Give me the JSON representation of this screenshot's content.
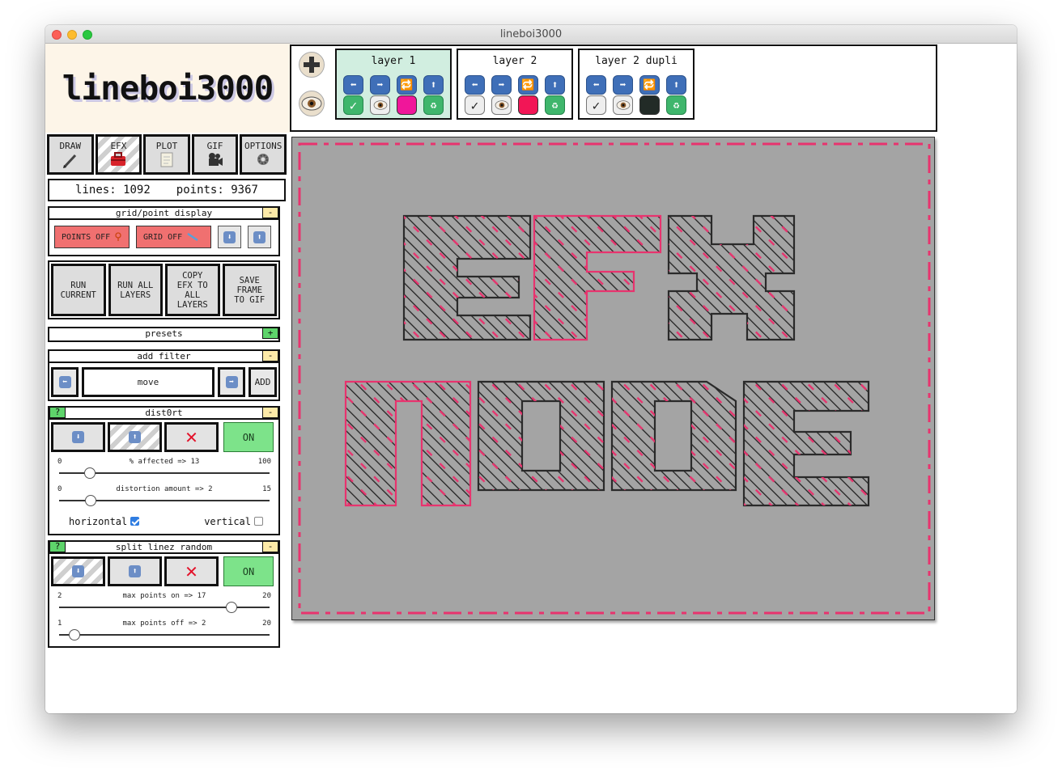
{
  "window": {
    "title": "lineboi3000"
  },
  "app": {
    "logo": "lineboi3000"
  },
  "modes": [
    {
      "label": "DRAW",
      "icon": "pen-icon",
      "active": false
    },
    {
      "label": "EFX",
      "icon": "toolbox-icon",
      "active": true
    },
    {
      "label": "PLOT",
      "icon": "paper-icon",
      "active": false
    },
    {
      "label": "GIF",
      "icon": "camera-icon",
      "active": false
    },
    {
      "label": "OPTIONS",
      "icon": "gear-icon",
      "active": false
    }
  ],
  "stats": {
    "lines_label": "lines:",
    "lines": "1092",
    "points_label": "points:",
    "points": "9367"
  },
  "grid_panel": {
    "title": "grid/point display",
    "toggle": "-",
    "points_btn": "POINTS OFF",
    "grid_btn": "GRID OFF"
  },
  "run": {
    "run_current": "RUN\nCURRENT",
    "run_all": "RUN ALL\nLAYERS",
    "copy_efx": "COPY\nEFX TO\nALL\nLAYERS",
    "save_frame": "SAVE\nFRAME\nTO GIF"
  },
  "presets": {
    "title": "presets",
    "toggle": "+"
  },
  "add_filter": {
    "title": "add filter",
    "toggle": "-",
    "current": "move",
    "add_label": "ADD"
  },
  "distort": {
    "title": "dist0rt",
    "help": "?",
    "toggle": "-",
    "on_label": "ON",
    "slider1": {
      "label": "% affected => 13",
      "min": "0",
      "max": "100",
      "value": 13
    },
    "slider2": {
      "label": "distortion amount => 2",
      "min": "0",
      "max": "15",
      "value": 2
    },
    "horizontal_label": "horizontal",
    "horizontal_checked": true,
    "vertical_label": "vertical",
    "vertical_checked": false
  },
  "split": {
    "title": "split linez random",
    "help": "?",
    "toggle": "-",
    "on_label": "ON",
    "slider1": {
      "label": "max points on => 17",
      "min": "2",
      "max": "20",
      "value": 17
    },
    "slider2": {
      "label": "max points off => 2",
      "min": "1",
      "max": "20",
      "value": 2
    }
  },
  "layers": [
    {
      "name": "layer 1",
      "active": true,
      "visible": true,
      "color": "#f0169a"
    },
    {
      "name": "layer 2",
      "active": false,
      "visible": false,
      "color": "#f21656"
    },
    {
      "name": "layer 2 dupli",
      "active": false,
      "visible": false,
      "color": "#222b27"
    }
  ],
  "colors": {
    "accent_pink": "#e8336e",
    "canvas_bg": "#a4a4a4",
    "on_green": "#7de38a",
    "off_red": "#f07070"
  },
  "canvas": {
    "line1": "EFX",
    "line2": "MODE"
  }
}
